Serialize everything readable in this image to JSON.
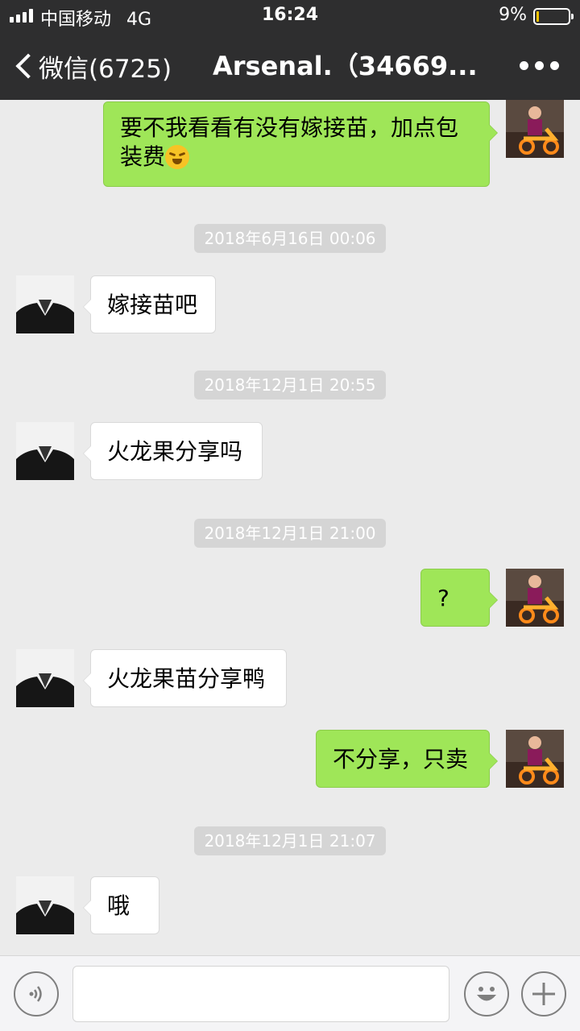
{
  "status_bar": {
    "carrier": "中国移动",
    "network": "4G",
    "time": "16:24",
    "battery_percent": "9%",
    "battery_level": 0.09,
    "battery_color": "#f5c400"
  },
  "nav": {
    "back_label": "微信(6725)",
    "title": "Arsenal.（34669..."
  },
  "messages": [
    {
      "side": "right",
      "text": "要不我看看有没有嫁接苗，加点包装费",
      "emoji": "rolling-on-floor-laughing-emoji"
    },
    {
      "type": "time",
      "text": "2018年6月16日 00:06"
    },
    {
      "side": "left",
      "text": "嫁接苗吧"
    },
    {
      "type": "time",
      "text": "2018年12月1日 20:55"
    },
    {
      "side": "left",
      "text": "火龙果分享吗"
    },
    {
      "type": "time",
      "text": "2018年12月1日 21:00"
    },
    {
      "side": "right",
      "text": "?"
    },
    {
      "side": "left",
      "text": "火龙果苗分享鸭"
    },
    {
      "side": "right",
      "text": "不分享，只卖"
    },
    {
      "type": "time",
      "text": "2018年12月1日 21:07"
    },
    {
      "side": "left",
      "text": "哦"
    }
  ],
  "input_bar": {
    "voice_icon": "voice-icon",
    "emoji_icon": "emoji-face-icon",
    "plus_icon": "plus-icon",
    "text_value": ""
  },
  "colors": {
    "nav_bg": "#2e2e2f",
    "chat_bg": "#ebebeb",
    "bubble_self": "#9fe658",
    "bubble_other": "#ffffff"
  }
}
